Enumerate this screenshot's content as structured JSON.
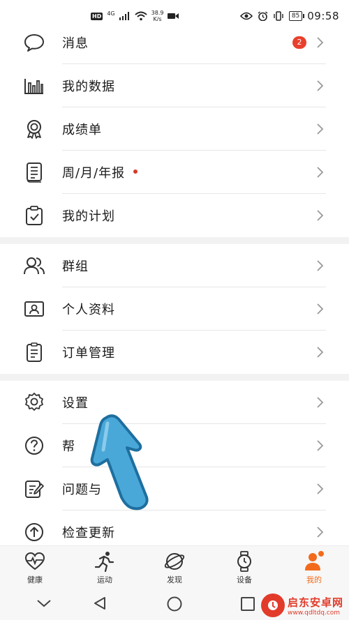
{
  "status_bar": {
    "hd": "HD",
    "network": "4G",
    "speed_value": "38.9",
    "speed_unit": "K/s",
    "battery": "85",
    "time": "09:58"
  },
  "group1": [
    {
      "label": "消息",
      "icon": "message-icon",
      "badge": "2"
    },
    {
      "label": "我的数据",
      "icon": "bar-chart-icon"
    },
    {
      "label": "成绩单",
      "icon": "medal-icon"
    },
    {
      "label": "周/月/年报",
      "icon": "report-icon",
      "dot": true
    },
    {
      "label": "我的计划",
      "icon": "clipboard-check-icon"
    }
  ],
  "group2": [
    {
      "label": "群组",
      "icon": "group-icon"
    },
    {
      "label": "个人资料",
      "icon": "profile-card-icon"
    },
    {
      "label": "订单管理",
      "icon": "order-icon"
    }
  ],
  "group3": [
    {
      "label": "设置",
      "icon": "gear-icon"
    },
    {
      "label": "帮",
      "icon": "help-icon"
    },
    {
      "label": "问题与",
      "icon": "feedback-icon"
    },
    {
      "label": "检查更新",
      "icon": "update-icon"
    }
  ],
  "tabs": [
    {
      "label": "健康",
      "icon": "heart-pulse-icon"
    },
    {
      "label": "运动",
      "icon": "runner-icon"
    },
    {
      "label": "发现",
      "icon": "planet-icon"
    },
    {
      "label": "设备",
      "icon": "watch-icon"
    },
    {
      "label": "我的",
      "icon": "person-icon",
      "active": true
    }
  ],
  "watermark": {
    "title": "启东安卓网",
    "url": "www.qdltdq.com"
  },
  "colors": {
    "accent": "#f26b1d",
    "badge": "#e8402c",
    "arrow": "#4aa8d8"
  }
}
